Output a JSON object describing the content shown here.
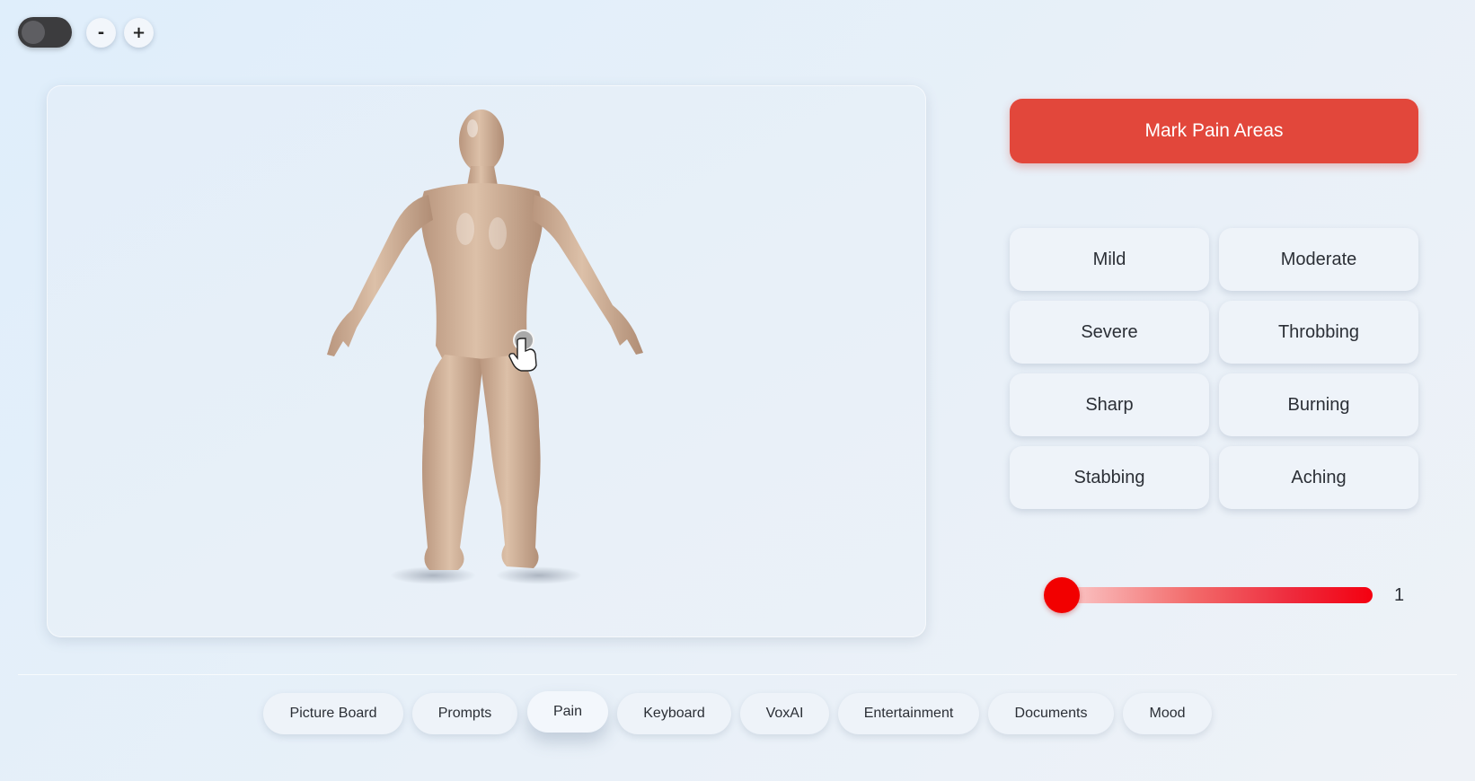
{
  "top_controls": {
    "toggle_state": "off",
    "zoom_out_label": "-",
    "zoom_in_label": "+"
  },
  "viewer": {
    "model": "human-body-3d",
    "cursor_icon": "hand-pointer-icon"
  },
  "panel": {
    "mark_button_label": "Mark Pain Areas",
    "pain_types": [
      "Mild",
      "Moderate",
      "Severe",
      "Throbbing",
      "Sharp",
      "Burning",
      "Stabbing",
      "Aching"
    ],
    "intensity": {
      "value": "1",
      "min": 1,
      "max": 10
    }
  },
  "nav": {
    "tabs": [
      "Picture Board",
      "Prompts",
      "Pain",
      "Keyboard",
      "VoxAI",
      "Entertainment",
      "Documents",
      "Mood"
    ],
    "active": "Pain"
  },
  "colors": {
    "accent_red": "#e2473b",
    "slider_thumb": "#f20000",
    "skin": "#d3b39a",
    "background": "#e3eef9"
  }
}
